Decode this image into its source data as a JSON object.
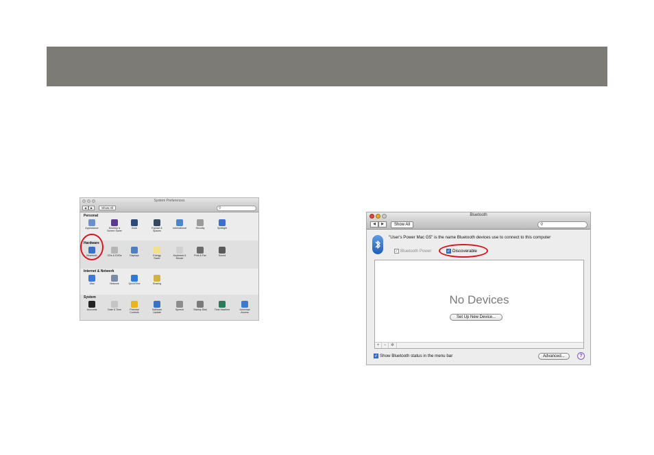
{
  "system_preferences": {
    "title": "System Preferences",
    "show_all": "Show All",
    "nav_back": "◀",
    "nav_forward": "▶",
    "search_icon": "magnifier",
    "sections": [
      {
        "name": "Personal",
        "items": [
          {
            "label": "Appearance",
            "icon": "appearance-icon",
            "color": "#6d8fc9"
          },
          {
            "label": "Desktop &\nScreen Saver",
            "icon": "desktop-icon",
            "color": "#5d3a8c"
          },
          {
            "label": "Dock",
            "icon": "dock-icon",
            "color": "#2f4a7a"
          },
          {
            "label": "Exposé &\nSpaces",
            "icon": "expose-icon",
            "color": "#34485e"
          },
          {
            "label": "International",
            "icon": "flag-icon",
            "color": "#4a86c8"
          },
          {
            "label": "Security",
            "icon": "security-icon",
            "color": "#9a9a9a"
          },
          {
            "label": "Spotlight",
            "icon": "spotlight-icon",
            "color": "#3d6fd1"
          }
        ]
      },
      {
        "name": "Hardware",
        "items": [
          {
            "label": "Bluetooth",
            "icon": "bluetooth-icon",
            "color": "#3a6fc4"
          },
          {
            "label": "CDs & DVDs",
            "icon": "cd-icon",
            "color": "#b5b5b5"
          },
          {
            "label": "Displays",
            "icon": "display-icon",
            "color": "#4f7fbf"
          },
          {
            "label": "Energy\nSaver",
            "icon": "bulb-icon",
            "color": "#f1e28a"
          },
          {
            "label": "Keyboard &\nMouse",
            "icon": "keyboard-icon",
            "color": "#d0d0d0"
          },
          {
            "label": "Print & Fax",
            "icon": "printer-icon",
            "color": "#6b6b6b"
          },
          {
            "label": "Sound",
            "icon": "speaker-icon",
            "color": "#5a5a5a"
          }
        ]
      },
      {
        "name": "Internet & Network",
        "items": [
          {
            "label": ".Mac",
            "icon": "mac-icon",
            "color": "#3c7ad6"
          },
          {
            "label": "Network",
            "icon": "network-icon",
            "color": "#7a8aa8"
          },
          {
            "label": "QuickTime",
            "icon": "quicktime-icon",
            "color": "#2f7ad3"
          },
          {
            "label": "Sharing",
            "icon": "sharing-icon",
            "color": "#d1b24a"
          }
        ]
      },
      {
        "name": "System",
        "items": [
          {
            "label": "Accounts",
            "icon": "accounts-icon",
            "color": "#222222"
          },
          {
            "label": "Date & Time",
            "icon": "clock-icon",
            "color": "#c4c4c4"
          },
          {
            "label": "Parental\nControls",
            "icon": "parental-icon",
            "color": "#e9b51b"
          },
          {
            "label": "Software\nUpdate",
            "icon": "update-icon",
            "color": "#3a73c6"
          },
          {
            "label": "Speech",
            "icon": "microphone-icon",
            "color": "#8c8c8c"
          },
          {
            "label": "Startup Disk",
            "icon": "disk-icon",
            "color": "#7a7a7a"
          },
          {
            "label": "Time Machine",
            "icon": "timemachine-icon",
            "color": "#2b7a5a"
          },
          {
            "label": "Universal\nAccess",
            "icon": "universal-access-icon",
            "color": "#3f78cf"
          }
        ]
      }
    ]
  },
  "bluetooth": {
    "title": "Bluetooth",
    "show_all": "Show All",
    "nav_back": "◀",
    "nav_forward": "▶",
    "description": "\"User's Power Mac G5\" is the name Bluetooth devices use to connect to this computer",
    "power_label": "Bluetooth Power",
    "power_checked": true,
    "discoverable_label": "Discoverable",
    "discoverable_checked": true,
    "no_devices": "No Devices",
    "setup_button": "Set Up New Device...",
    "add": "+",
    "remove": "−",
    "gear": "✲",
    "status_label": "Show Bluetooth status in the menu bar",
    "status_checked": true,
    "advanced_button": "Advanced...",
    "help": "?"
  },
  "colors": {
    "banner": "#7c7b76",
    "highlight_red": "#d6151d",
    "close_red": "#e0443e",
    "minimize_yellow": "#e8a92e",
    "zoom_grey": "#c9c9c9"
  }
}
